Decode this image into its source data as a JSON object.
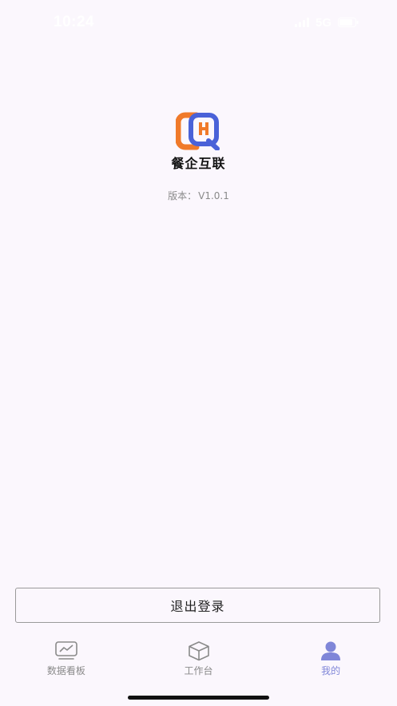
{
  "status_bar": {
    "time": "10:24",
    "network": "5G"
  },
  "app": {
    "name": "餐企互联",
    "version_label": "版本：",
    "version": "V1.0.1"
  },
  "logout_label": "退出登录",
  "tabs": [
    {
      "label": "数据看板",
      "icon": "chart-board-icon",
      "active": false
    },
    {
      "label": "工作台",
      "icon": "box-icon",
      "active": false
    },
    {
      "label": "我的",
      "icon": "user-icon",
      "active": true
    }
  ],
  "colors": {
    "background": "#fbf7fd",
    "logo_orange": "#f07a2a",
    "logo_blue": "#4a62d8",
    "tab_active": "#7f86d8",
    "tab_inactive": "#8a8a8a"
  }
}
